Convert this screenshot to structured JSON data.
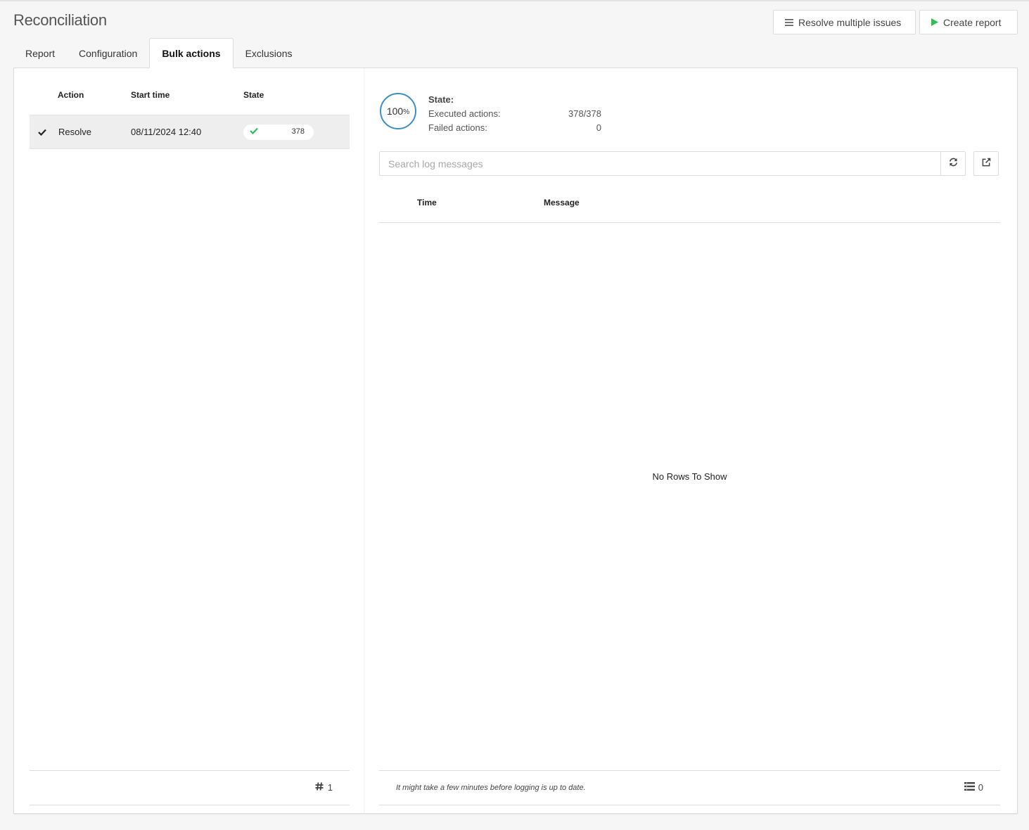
{
  "page": {
    "title": "Reconciliation"
  },
  "toolbar": {
    "resolve_label": "Resolve multiple issues",
    "create_label": "Create report",
    "create_icon_color": "#2ebd59"
  },
  "tabs": [
    {
      "label": "Report",
      "active": false
    },
    {
      "label": "Configuration",
      "active": false
    },
    {
      "label": "Bulk actions",
      "active": true
    },
    {
      "label": "Exclusions",
      "active": false
    }
  ],
  "actions_grid": {
    "columns": [
      "Action",
      "Start time",
      "State"
    ],
    "rows": [
      {
        "action": "Resolve",
        "start_time": "08/11/2024 12:40",
        "state_count": "378",
        "state_icon": "check-icon",
        "selected": true
      }
    ],
    "footer_count": "1"
  },
  "detail": {
    "progress": "100",
    "progress_unit": "%",
    "state_label": "State:",
    "executed_label": "Executed actions:",
    "executed_value": "378/378",
    "failed_label": "Failed actions:",
    "failed_value": "0",
    "search_placeholder": "Search log messages",
    "log_columns": [
      "Time",
      "Message"
    ],
    "empty_text": "No Rows To Show",
    "footer_hint": "It might take a few minutes before logging is up to date.",
    "footer_count": "0"
  },
  "colors": {
    "accent_blue": "#3a8fc9",
    "success_green": "#2ebd59"
  }
}
